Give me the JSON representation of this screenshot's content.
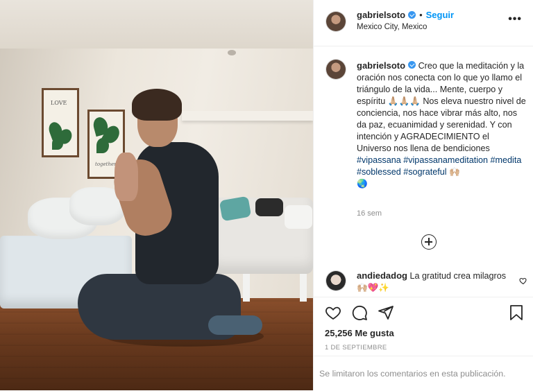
{
  "header": {
    "username": "gabrielsoto",
    "follow_label": "Seguir",
    "separator": "•",
    "location": "Mexico City, Mexico",
    "more_label": "•••"
  },
  "caption": {
    "username": "gabrielsoto",
    "text": "Creo que la meditación y la oración nos conecta con lo que yo llamo el triángulo de la vida... Mente, cuerpo y espíritu 🙏🏼🙏🏼🙏🏼 Nos eleva nuestro nivel de conciencia, nos hace vibrar más alto, nos da paz, ecuanimidad y serenidad. Y con intención y AGRADECIMIENTO el Universo nos llena de bendiciones",
    "hashtags": "#vipassana #vipassanameditation #medita #soblessed #sograteful",
    "hashtag_emoji": "🙌🏼",
    "trailing_emoji": "🌏",
    "time_ago": "16 sem"
  },
  "comment": {
    "username": "andiedadog",
    "text": "La gratitud crea milagros 🙌🏼💖✨"
  },
  "stats": {
    "likes": "25,256 Me gusta",
    "date": "1 DE SEPTIEMBRE"
  },
  "footer": {
    "text": "Se limitaron los comentarios en esta publicación."
  },
  "photo": {
    "frame1_text": "LOVE",
    "frame2_text": "together"
  },
  "colors": {
    "link_blue": "#0095f6",
    "hashtag": "#00376b",
    "muted": "#8e8e8e",
    "verified": "#3897f0"
  }
}
